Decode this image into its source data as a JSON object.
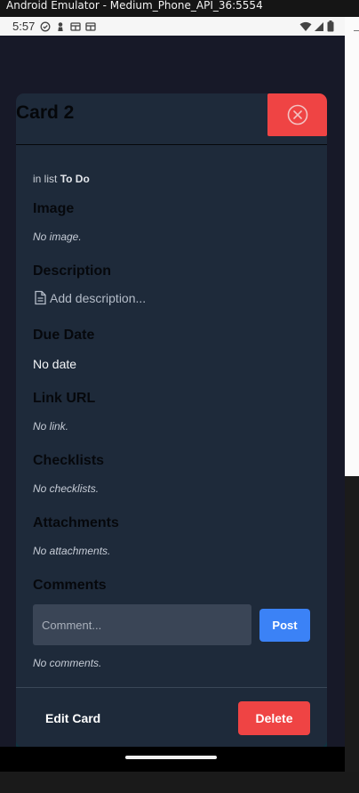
{
  "window": {
    "title": "Android Emulator - Medium_Phone_API_36:5554"
  },
  "statusbar": {
    "time": "5:57"
  },
  "card": {
    "title": "Card 2",
    "in_list_prefix": "in list",
    "list_name": "To Do"
  },
  "sections": {
    "image": {
      "title": "Image",
      "empty": "No image."
    },
    "description": {
      "title": "Description",
      "placeholder": "Add description..."
    },
    "due_date": {
      "title": "Due Date",
      "value": "No date"
    },
    "link": {
      "title": "Link URL",
      "empty": "No link."
    },
    "checklists": {
      "title": "Checklists",
      "empty": "No checklists."
    },
    "attachments": {
      "title": "Attachments",
      "empty": "No attachments."
    },
    "comments": {
      "title": "Comments",
      "placeholder": "Comment...",
      "post_label": "Post",
      "empty": "No comments."
    }
  },
  "footer": {
    "edit_label": "Edit Card",
    "delete_label": "Delete"
  },
  "colors": {
    "danger": "#ef4444",
    "primary": "#3b82f6",
    "surface": "#1e2a3a"
  },
  "icons": [
    "check-circle-icon",
    "person-icon",
    "card-icon",
    "wifi-icon",
    "signal-icon",
    "battery-icon",
    "close-circle-icon",
    "document-icon"
  ]
}
